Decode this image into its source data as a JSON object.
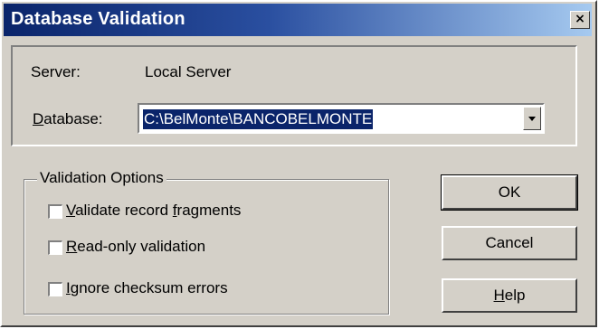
{
  "window": {
    "title": "Database Validation",
    "close_glyph": "×"
  },
  "server": {
    "label": "Server:",
    "value": "Local Server"
  },
  "database": {
    "label_prefix": "",
    "label_mnemonic": "D",
    "label_suffix": "atabase:",
    "value": "C:\\BelMonte\\BANCOBELMONTE"
  },
  "validation_options": {
    "title": "Validation Options",
    "items": [
      {
        "prefix": "",
        "mnemonic": "V",
        "suffix": "alidate record ",
        "mnemonic2": "f",
        "suffix2": "ragments",
        "checked": false
      },
      {
        "prefix": "",
        "mnemonic": "R",
        "suffix": "ead-only validation",
        "mnemonic2": "",
        "suffix2": "",
        "checked": false
      },
      {
        "prefix": "",
        "mnemonic": "I",
        "suffix": "gnore checksum errors",
        "mnemonic2": "",
        "suffix2": "",
        "checked": false
      }
    ]
  },
  "buttons": {
    "ok": "OK",
    "cancel": "Cancel",
    "help_mnemonic": "H",
    "help_suffix": "elp"
  },
  "icons": {
    "close": "close-icon",
    "dropdown": "chevron-down-icon"
  }
}
